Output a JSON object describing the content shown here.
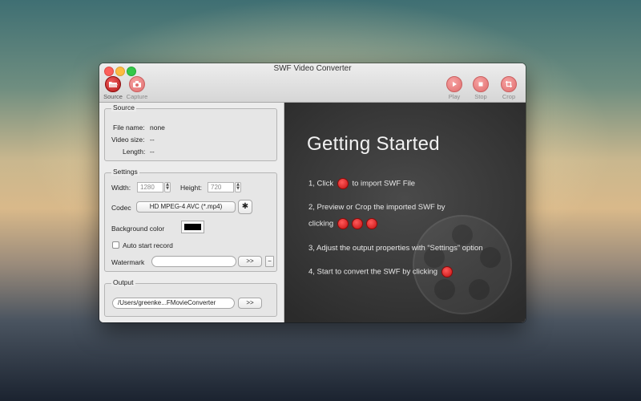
{
  "window": {
    "title": "SWF Video Converter"
  },
  "toolbar": {
    "source_label": "Source",
    "capture_label": "Capture",
    "play_label": "Play",
    "stop_label": "Stop",
    "crop_label": "Crop"
  },
  "source_group": {
    "title": "Source",
    "file_name_label": "File name:",
    "file_name_value": "none",
    "video_size_label": "Video size:",
    "video_size_value": "--",
    "length_label": "Length:",
    "length_value": "--"
  },
  "settings_group": {
    "title": "Settings",
    "width_label": "Width:",
    "width_value": "1280",
    "height_label": "Height:",
    "height_value": "720",
    "codec_label": "Codec",
    "codec_value": "HD MPEG-4 AVC (*.mp4)",
    "bg_color_label": "Background color",
    "bg_color_value": "#000000",
    "auto_start_label": "Auto start record",
    "watermark_label": "Watermark",
    "watermark_value": "",
    "browse_label": ">>",
    "minus_label": "−"
  },
  "output_group": {
    "title": "Output",
    "path_value": "/Users/greenke...FMovieConverter",
    "browse_label": ">>"
  },
  "getting_started": {
    "title": "Getting Started",
    "step1_pre": "1, Click",
    "step1_post": "to import SWF File",
    "step2_line1": "2, Preview or Crop the imported SWF by",
    "step2_line2": "clicking",
    "step3": "3, Adjust the output properties with “Settings” option",
    "step4": "4, Start to convert the SWF by clicking"
  },
  "colors": {
    "accent_red": "#c41010",
    "dark_panel": "#2b2b2b"
  }
}
